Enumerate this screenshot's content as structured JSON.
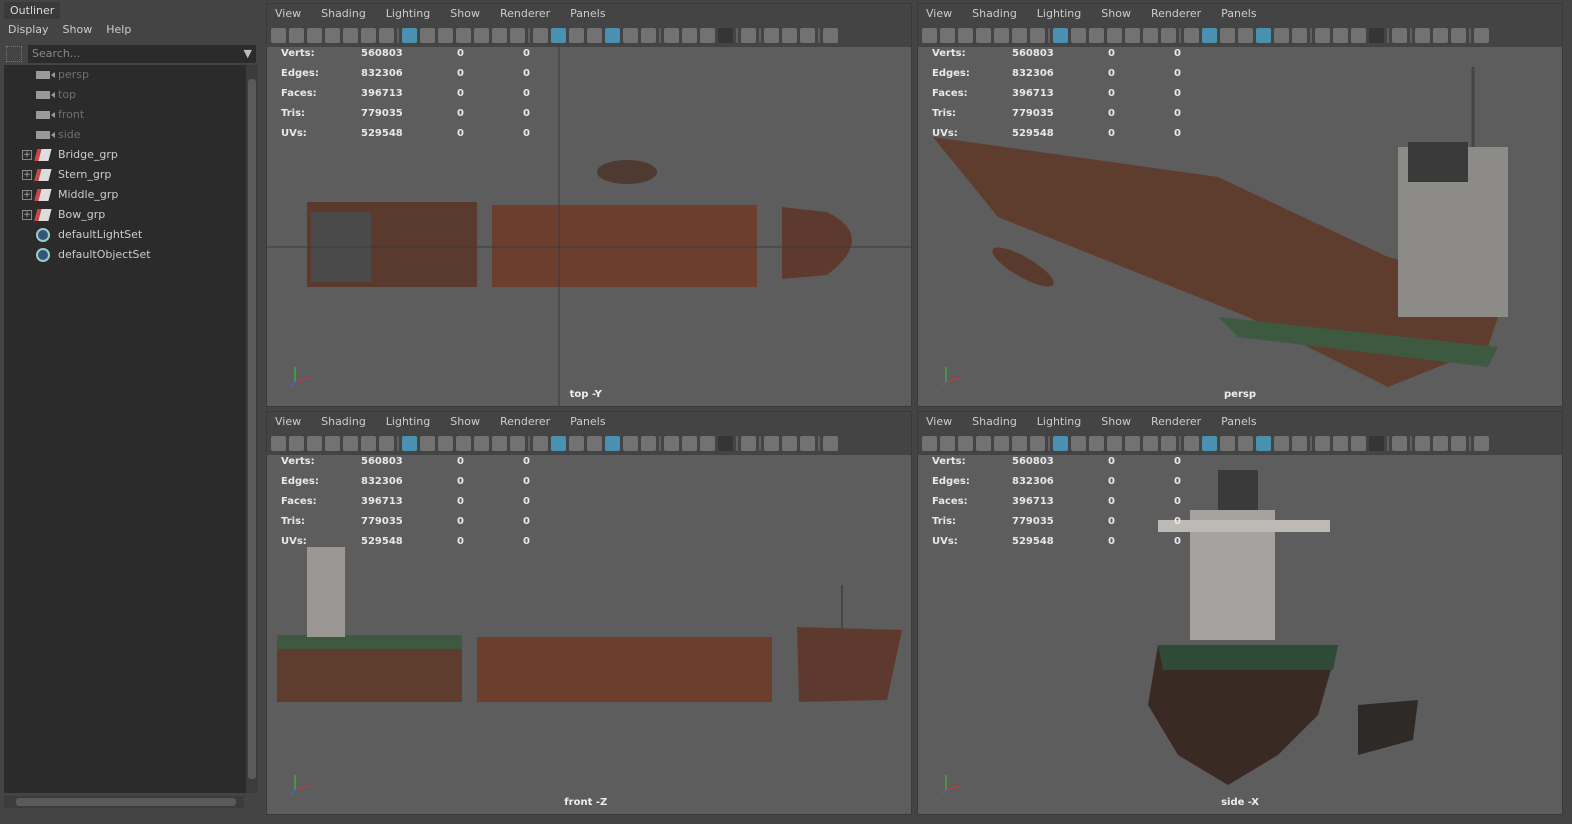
{
  "outliner": {
    "tab": "Outliner",
    "menu": [
      "Display",
      "Show",
      "Help"
    ],
    "search_placeholder": "Search...",
    "items": [
      {
        "label": "persp",
        "type": "camera",
        "dim": true
      },
      {
        "label": "top",
        "type": "camera",
        "dim": true
      },
      {
        "label": "front",
        "type": "camera",
        "dim": true
      },
      {
        "label": "side",
        "type": "camera",
        "dim": true
      },
      {
        "label": "Bridge_grp",
        "type": "group"
      },
      {
        "label": "Stern_grp",
        "type": "group"
      },
      {
        "label": "Middle_grp",
        "type": "group"
      },
      {
        "label": "Bow_grp",
        "type": "group"
      },
      {
        "label": "defaultLightSet",
        "type": "set"
      },
      {
        "label": "defaultObjectSet",
        "type": "set"
      }
    ]
  },
  "panel_menu": [
    "View",
    "Shading",
    "Lighting",
    "Show",
    "Renderer",
    "Panels"
  ],
  "toolbar_icons": [
    "camera-select-icon",
    "camera-lock-icon",
    "camera-attr-icon",
    "bookmark-icon",
    "image-plane-icon",
    "2d-pan-icon",
    "grease-pencil-icon",
    "sep",
    "grid-icon",
    "film-gate-icon",
    "resolution-gate-icon",
    "gate-mask-icon",
    "field-chart-icon",
    "safe-action-icon",
    "safe-title-icon",
    "sep",
    "wireframe-icon",
    "smooth-shade-icon",
    "default-material-icon",
    "wireframe-on-shaded-icon",
    "xray-icon",
    "use-lights-icon",
    "shadows-icon",
    "sep",
    "ambient-occlusion-icon",
    "motion-blur-icon",
    "anti-alias-icon",
    "depth-of-field-icon",
    "sep",
    "isolate-select-icon",
    "sep",
    "xray-joints-icon",
    "xray-active-icon",
    "backface-icon",
    "sep",
    "hud-icon"
  ],
  "toolbar_active": [
    8,
    17,
    20
  ],
  "hud": {
    "labels": [
      "Verts:",
      "Edges:",
      "Faces:",
      "Tris:",
      "UVs:"
    ],
    "values": [
      [
        "560803",
        "0",
        "0"
      ],
      [
        "832306",
        "0",
        "0"
      ],
      [
        "396713",
        "0",
        "0"
      ],
      [
        "779035",
        "0",
        "0"
      ],
      [
        "529548",
        "0",
        "0"
      ]
    ]
  },
  "viewports": [
    {
      "label": "top -Y"
    },
    {
      "label": "persp"
    },
    {
      "label": "front -Z"
    },
    {
      "label": "side -X"
    }
  ]
}
